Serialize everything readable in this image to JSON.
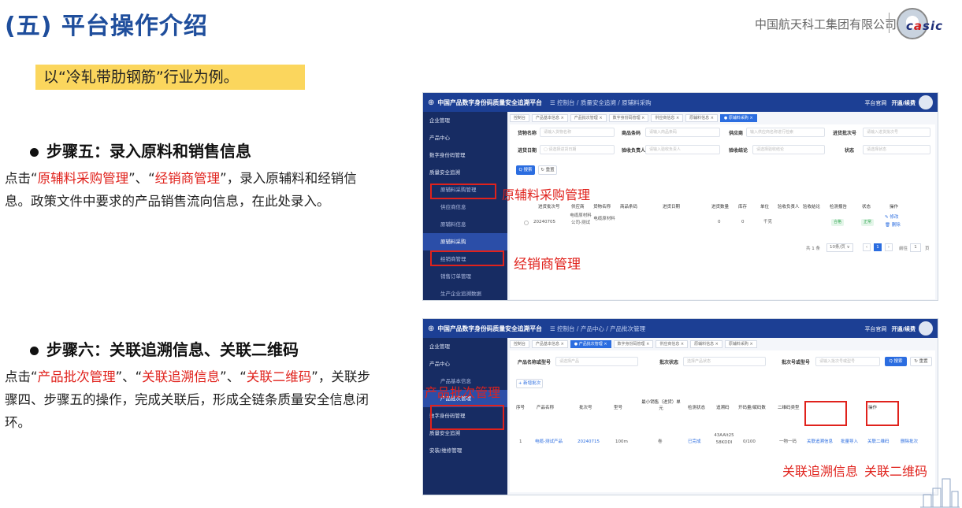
{
  "header": {
    "title": "(五) 平台操作介绍",
    "company": "中国航天科工集团有限公司",
    "logo_text": "casic"
  },
  "example": "以“冷轧带肋钢筋”行业为例。",
  "step5": {
    "heading": "步骤五：录入原料和销售信息",
    "para": [
      {
        "t": "点击“",
        "r": false
      },
      {
        "t": "原辅料采购管理",
        "r": true
      },
      {
        "t": "”、“",
        "r": false
      },
      {
        "t": "经销商管理",
        "r": true
      },
      {
        "t": "”，录入原辅料和经销信息。政策文件中要求的产品销售流向信息，在此处录入。",
        "r": false
      }
    ]
  },
  "step6": {
    "heading": "步骤六：关联追溯信息、关联二维码",
    "para": [
      {
        "t": "点击“",
        "r": false
      },
      {
        "t": "产品批次管理",
        "r": true
      },
      {
        "t": "”、“",
        "r": false
      },
      {
        "t": "关联追溯信息",
        "r": true
      },
      {
        "t": "”、“",
        "r": false
      },
      {
        "t": "关联二维码",
        "r": true
      },
      {
        "t": "”，关联步骤四、步骤五的操作，完成关联后，形成全链条质量安全信息闭环。",
        "r": false
      }
    ]
  },
  "shot1": {
    "app_title": "中国产品数字身份码质量安全追溯平台",
    "breadcrumb": "☰  控制台 / 质量安全追溯 / 原辅料采购",
    "top_right": [
      "平台官网",
      "开通/续费"
    ],
    "sidebar": [
      {
        "label": "企业管理",
        "cls": ""
      },
      {
        "label": "产品中心",
        "cls": ""
      },
      {
        "label": "数字身份码管理",
        "cls": ""
      },
      {
        "label": "质量安全追溯",
        "cls": ""
      },
      {
        "label": "原辅料采购管理",
        "cls": "sub"
      },
      {
        "label": "供应商信息",
        "cls": "sub"
      },
      {
        "label": "原辅料信息",
        "cls": "sub"
      },
      {
        "label": "原辅料采购",
        "cls": "sub act"
      },
      {
        "label": "经销商管理",
        "cls": "sub"
      },
      {
        "label": "销售订单管理",
        "cls": "sub"
      },
      {
        "label": "生产企业追溯数据",
        "cls": "sub"
      }
    ],
    "tabs": [
      {
        "l": "控制台",
        "a": false
      },
      {
        "l": "产品基本信息 ×",
        "a": false
      },
      {
        "l": "产品批次管理 ×",
        "a": false
      },
      {
        "l": "数字身份码管理 ×",
        "a": false
      },
      {
        "l": "供应商信息 ×",
        "a": false
      },
      {
        "l": "原辅料信息 ×",
        "a": false
      },
      {
        "l": "● 原辅料采购 ×",
        "a": true
      }
    ],
    "filters": {
      "l1": "货物名称",
      "p1": "请输入货物名称",
      "l2": "商品条码",
      "p2": "请输入商品条码",
      "l3": "供应商",
      "p3": "输入供应商名称进行检索",
      "l4": "进货批次号",
      "p4": "请输入进货批次号",
      "l5": "进货日期",
      "p5": "▢ 请选择进货日期",
      "l6": "验收负责人",
      "p6": "请输入验收负责人",
      "l7": "验收结论",
      "p7": "请选择验收结论",
      "l8": "状态",
      "p8": "请选择状态"
    },
    "search": "Q 搜索",
    "reset": "↻ 重置",
    "columns": [
      "进货批次号",
      "供应商",
      "货物名称",
      "商品条码",
      "进货日期",
      "进货数量",
      "库存",
      "单位",
      "验收负责人",
      "验收结论",
      "检测报告",
      "状态",
      "操作"
    ],
    "row": {
      "batch": "20240705",
      "supplier": "电缆原材料公司-测试",
      "goods": "电缆原材料",
      "qty": "0",
      "stock": "0",
      "unit": "千克",
      "result": "合格",
      "status": "正常",
      "op1": "✎ 修改",
      "op2": "🗑 删除"
    },
    "pagination": {
      "total": "共 1 条",
      "size": "10条/页 ∨",
      "page": "1",
      "goto": "前往",
      "goto_val": "1",
      "unit": "页"
    },
    "callout_a": "原辅料采购管理",
    "callout_b": "经销商管理"
  },
  "shot2": {
    "app_title": "中国产品数字身份码质量安全追溯平台",
    "breadcrumb": "☰  控制台 / 产品中心 / 产品批次管理",
    "top_right": [
      "平台官网",
      "开通/续费"
    ],
    "sidebar": [
      {
        "label": "企业管理",
        "cls": ""
      },
      {
        "label": "产品中心",
        "cls": ""
      },
      {
        "label": "产品基本信息",
        "cls": "sub"
      },
      {
        "label": "产品批次管理",
        "cls": "sub act"
      },
      {
        "label": "数字身份码管理",
        "cls": ""
      },
      {
        "label": "质量安全追溯",
        "cls": ""
      },
      {
        "label": "安装/维修管理",
        "cls": ""
      }
    ],
    "tabs": [
      {
        "l": "控制台",
        "a": false
      },
      {
        "l": "产品基本信息 ×",
        "a": false
      },
      {
        "l": "● 产品批次管理 ×",
        "a": true
      },
      {
        "l": "数字身份码管理 ×",
        "a": false
      },
      {
        "l": "供应商信息 ×",
        "a": false
      },
      {
        "l": "原辅料信息 ×",
        "a": false
      },
      {
        "l": "原辅料采购 ×",
        "a": false
      }
    ],
    "filters": {
      "l1": "产品名称或型号",
      "p1": "请选择产品",
      "l2": "批次状态",
      "p2": "选择产品状态",
      "l3": "批次号或型号",
      "p3": "请输入批次号或型号"
    },
    "search": "Q 搜索",
    "reset": "↻ 重置",
    "add": "+ 新增批次",
    "columns": [
      "序号",
      "产品名称",
      "批次号",
      "型号",
      "最小销售（进货）单元",
      "检测状态",
      "追溯码",
      "开码量/赋码数",
      "二维码类型",
      "操作"
    ],
    "row": {
      "idx": "1",
      "name": "电缆-测试产品",
      "batch": "20240715",
      "model": "100m",
      "unit": "卷",
      "status": "已完成",
      "code": "43AAlt2558KDDI",
      "ratio": "0/100",
      "qr": "一物一码",
      "op1": "关联追溯信息",
      "op2": "批量导入",
      "op3": "关联二维码",
      "op4": "删除批次"
    },
    "callout_a": "产品批次管理",
    "callout_b": "关联追溯信息",
    "callout_c": "关联二维码"
  }
}
